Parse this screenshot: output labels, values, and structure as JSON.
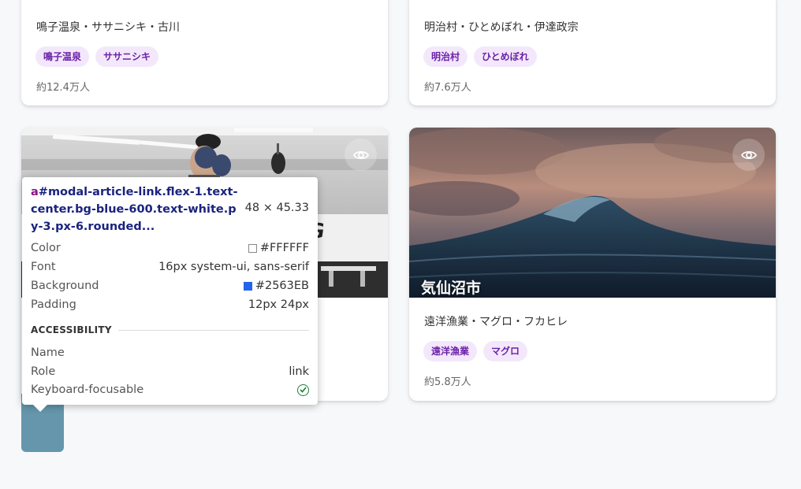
{
  "cards": [
    {
      "desc": "鳴子温泉・ササニシキ・古川",
      "tags": [
        "鳴子温泉",
        "ササニシキ"
      ],
      "population": "約12.4万人"
    },
    {
      "desc": "明治村・ひとめぼれ・伊達政宗",
      "tags": [
        "明治村",
        "ひとめぼれ"
      ],
      "population": "約7.6万人"
    },
    {
      "desc": "",
      "tags": [],
      "population": ""
    },
    {
      "title": "気仙沼市",
      "desc": "遠洋漁業・マグロ・フカヒレ",
      "tags": [
        "遠洋漁業",
        "マグロ"
      ],
      "population": "約5.8万人"
    }
  ],
  "icons": {
    "view": "eye-icon",
    "keyboard_focusable": "check-circle-icon"
  },
  "tooltip": {
    "tag": "a",
    "selector": "#modal-article-link.flex-1.text-center.bg-blue-600.text-white.py-3.px-6.rounded...",
    "size": "48 × 45.33",
    "rows": [
      {
        "label": "Color",
        "value": "#FFFFFF",
        "swatch": "#FFFFFF"
      },
      {
        "label": "Font",
        "value": "16px system-ui, sans-serif"
      },
      {
        "label": "Background",
        "value": "#2563EB",
        "swatch": "#2563EB"
      },
      {
        "label": "Padding",
        "value": "12px 24px"
      }
    ],
    "accessibility_heading": "ACCESSIBILITY",
    "a11y": [
      {
        "label": "Name",
        "value": ""
      },
      {
        "label": "Role",
        "value": "link"
      },
      {
        "label": "Keyboard-focusable",
        "value": ""
      }
    ]
  },
  "colors": {
    "tag_bg": "#F3E8FB",
    "tag_text": "#6B21A8",
    "check": "#188038"
  }
}
